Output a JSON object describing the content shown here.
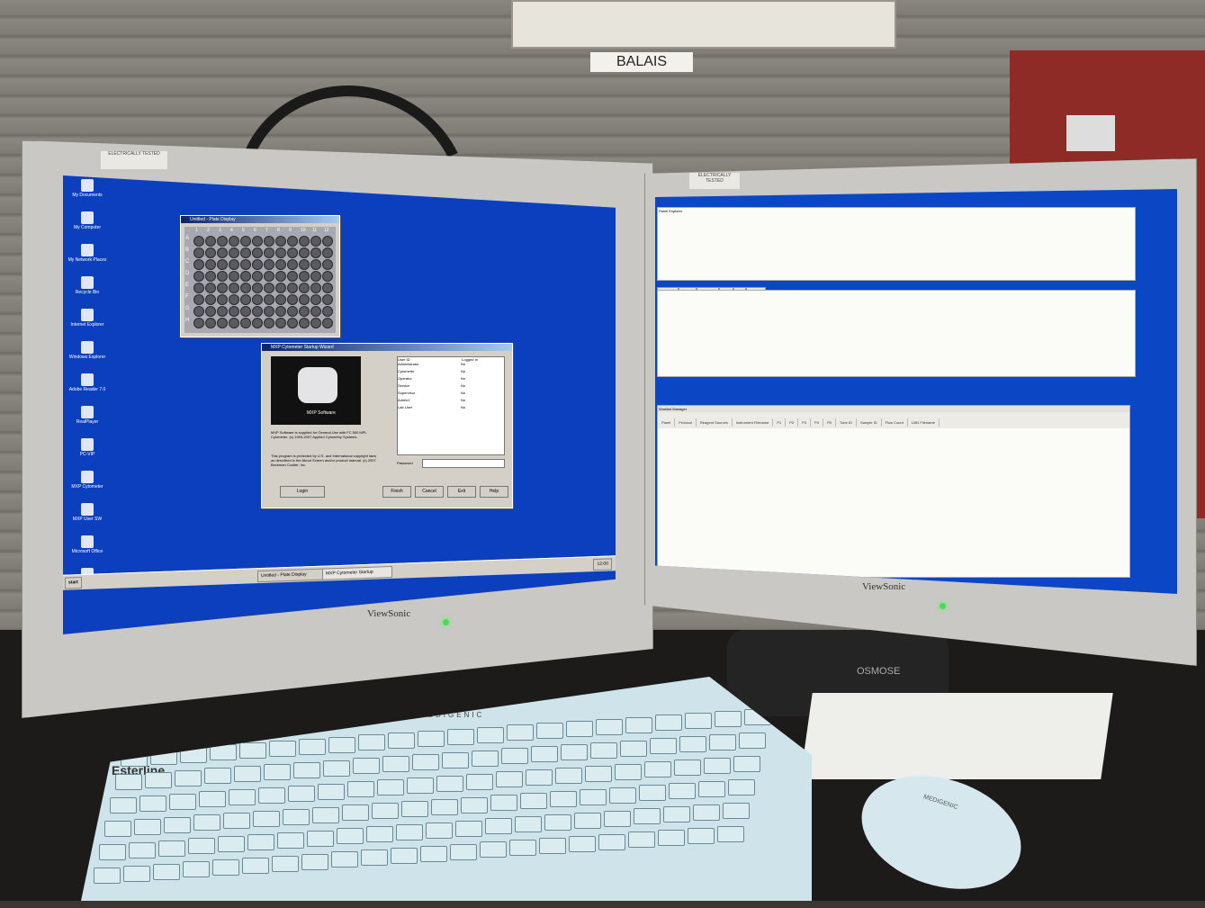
{
  "room": {
    "sign": "BALAIS"
  },
  "left_monitor": {
    "brand": "ViewSonic",
    "sticker": "ELECTRICALLY TESTED",
    "desktop_icons": [
      "My Documents",
      "My Computer",
      "My Network Places",
      "Recycle Bin",
      "Internet Explorer",
      "Windows Explorer",
      "Adobe Reader 7.0",
      "RealPlayer",
      "PC-VIP",
      "MXP Cytometer",
      "MXP User SW",
      "Microsoft Office",
      "Shortcut"
    ],
    "plate_window": {
      "title": "Untitled - Plate Display",
      "columns": [
        "1",
        "2",
        "3",
        "4",
        "5",
        "6",
        "7",
        "8",
        "9",
        "10",
        "11",
        "12"
      ],
      "rows": [
        "A",
        "B",
        "C",
        "D",
        "E",
        "F",
        "G",
        "H"
      ]
    },
    "wizard": {
      "title": "MXP Cytometer Startup Wizard",
      "product": "MXP Software",
      "text1": "MXP Software is supplied for General Use with FC 500 MPL Cytometer. (c) 1993-2007 Applied Cytometry Systems.",
      "text2": "This program is protected by U.S. and International copyright laws as described in the About Screen and/or product manual. (c) 2007 Beckman Coulter, Inc.",
      "list_headers": [
        "User ID",
        "Logged In"
      ],
      "users": [
        "Administrator",
        "Cytometer",
        "Operator",
        "Service",
        "Supervisor",
        "Admin2",
        "Lab User"
      ],
      "logged": [
        "No",
        "No",
        "No",
        "No",
        "No",
        "No",
        "No"
      ],
      "password_label": "Password",
      "buttons": [
        "Login",
        "Finish",
        "Cancel",
        "Exit",
        "Help"
      ]
    },
    "taskbar": {
      "start": "start",
      "items": [
        "Untitled - Plate Display",
        "MXP Cytometer Startup"
      ],
      "clock": "12:00"
    }
  },
  "right_monitor": {
    "brand": "ViewSonic",
    "sticker": "ELECTRICALLY TESTED",
    "top_panel_title": "Panel Explorer",
    "tabs": [
      "Products",
      "Panels",
      "Protocols",
      "LMD",
      "QC",
      "Support"
    ],
    "grid_title": "Worklist Manager",
    "columns": [
      "Panel",
      "Protocol",
      "Reagent Sources",
      "Instrument Filename",
      "P1",
      "P2",
      "P3",
      "P4",
      "P5",
      "Tube ID",
      "Sample ID",
      "Flow Count",
      "LMD Filename"
    ]
  },
  "keyboard": {
    "brand": "Esterline",
    "model": "MEDIGENIC"
  },
  "mouse": {
    "brand": "MEDIGENIC"
  },
  "hub": {
    "brand": "OSMOSE"
  }
}
